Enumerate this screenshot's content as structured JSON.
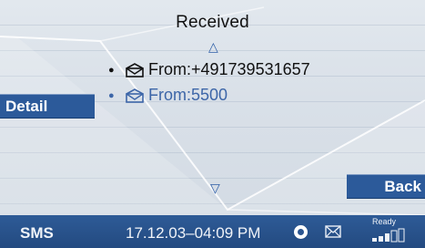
{
  "screen": {
    "title": "Received"
  },
  "messages": [
    {
      "label": "From:+491739531657",
      "state": "selected"
    },
    {
      "label": "From:5500",
      "state": "unselected"
    }
  ],
  "softkeys": {
    "detail": "Detail",
    "back": "Back"
  },
  "status": {
    "mode": "SMS",
    "datetime": "17.12.03–04:09 PM",
    "network": "Ready"
  },
  "colors": {
    "accent": "#2c5a9a",
    "status_bar": "#2a5590",
    "unselected_text": "#3d66a8",
    "background": "#dde4eb"
  },
  "icons": [
    "up-arrow-icon",
    "down-arrow-icon",
    "bullet-icon",
    "open-envelope-icon",
    "status-circle-icon",
    "envelope-icon",
    "signal-strength-icon"
  ]
}
